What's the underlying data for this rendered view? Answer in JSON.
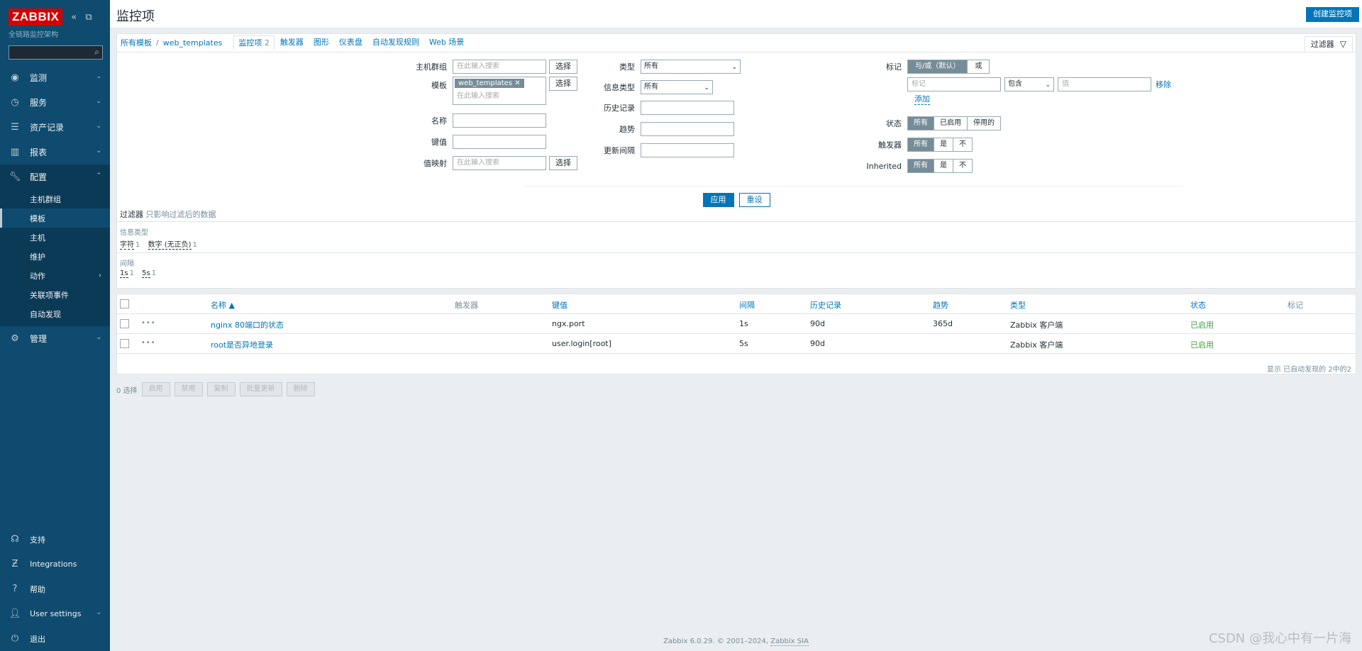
{
  "sidebar": {
    "logo": "ZABBIX",
    "collapse_icons": "«  ⧉",
    "subtitle": "全链路监控架构",
    "search_placeholder": "",
    "menu": [
      {
        "label": "监测",
        "icon": "eye-icon"
      },
      {
        "label": "服务",
        "icon": "clock-icon"
      },
      {
        "label": "资产记录",
        "icon": "list-icon"
      },
      {
        "label": "报表",
        "icon": "chart-icon"
      },
      {
        "label": "配置",
        "icon": "wrench-icon"
      },
      {
        "label": "管理",
        "icon": "gear-icon"
      }
    ],
    "submenu": [
      "主机群组",
      "模板",
      "主机",
      "维护",
      "动作",
      "关联项事件",
      "自动发现"
    ],
    "bottom": [
      {
        "label": "支持",
        "icon": "headset-icon"
      },
      {
        "label": "Integrations",
        "icon": "integrations-icon"
      },
      {
        "label": "帮助",
        "icon": "help-icon"
      },
      {
        "label": "User settings",
        "icon": "user-icon"
      },
      {
        "label": "退出",
        "icon": "power-icon"
      }
    ]
  },
  "header": {
    "title": "监控项",
    "create_button": "创建监控项"
  },
  "breadcrumbs": {
    "all_templates": "所有模板",
    "separator": "/",
    "template": "web_templates",
    "tabs": [
      {
        "label": "监控项",
        "count": "2"
      },
      {
        "label": "触发器",
        "count": ""
      },
      {
        "label": "图形",
        "count": ""
      },
      {
        "label": "仪表盘",
        "count": ""
      },
      {
        "label": "自动发现规则",
        "count": ""
      },
      {
        "label": "Web 场景",
        "count": ""
      }
    ],
    "filter_tab": "过滤器"
  },
  "filter": {
    "host_groups_label": "主机群组",
    "host_groups_placeholder": "在此输入搜索",
    "select_button": "选择",
    "templates_label": "模板",
    "templates_chip": "web_templates",
    "templates_placeholder": "在此输入搜索",
    "name_label": "名称",
    "key_label": "键值",
    "value_map_label": "值映射",
    "value_map_placeholder": "在此输入搜索",
    "type_label": "类型",
    "type_value": "所有",
    "info_type_label": "信息类型",
    "info_type_value": "所有",
    "history_label": "历史记录",
    "trends_label": "趋势",
    "update_interval_label": "更新间隔",
    "tags_label": "标记",
    "tags_and_or": "与/或（默认）",
    "tags_or": "或",
    "tag_placeholder": "标记",
    "tag_op": "包含",
    "value_placeholder": "值",
    "remove": "移除",
    "add": "添加",
    "state_label": "状态",
    "state_options": [
      "所有",
      "已启用",
      "停用的"
    ],
    "triggers_label": "触发器",
    "triggers_options": [
      "所有",
      "是",
      "不"
    ],
    "inherited_label": "Inherited",
    "inherited_options": [
      "所有",
      "是",
      "不"
    ],
    "apply": "应用",
    "reset": "重设"
  },
  "subfilter": {
    "title": "过滤器",
    "hint": "只影响过滤后的数据",
    "info_type_label": "信息类型",
    "info_type_values": [
      {
        "v": "字符",
        "c": "1"
      },
      {
        "v": "数字 (无正负)",
        "c": "1"
      }
    ],
    "interval_label": "间隔",
    "interval_values": [
      {
        "v": "1s",
        "c": "1"
      },
      {
        "v": "5s",
        "c": "1"
      }
    ]
  },
  "table": {
    "columns": [
      "名称 ▲",
      "触发器",
      "键值",
      "间隔",
      "历史记录",
      "趋势",
      "类型",
      "状态",
      "标记"
    ],
    "rows": [
      {
        "name": "nginx 80端口的状态",
        "trigger": "",
        "key": "ngx.port",
        "interval": "1s",
        "history": "90d",
        "trends": "365d",
        "type": "Zabbix 客户端",
        "status": "已启用",
        "tags": ""
      },
      {
        "name": "root是否异地登录",
        "trigger": "",
        "key": "user.login[root]",
        "interval": "5s",
        "history": "90d",
        "trends": "",
        "type": "Zabbix 客户端",
        "status": "已启用",
        "tags": ""
      }
    ],
    "footer": "显示 已自动发现的 2中的2"
  },
  "mass": {
    "selected": "0 选择",
    "buttons": [
      "启用",
      "禁用",
      "复制",
      "批量更新",
      "删除"
    ]
  },
  "footer": {
    "text": "Zabbix 6.0.29. © 2001–2024,",
    "link": "Zabbix SIA"
  },
  "watermark": "CSDN @我心中有一片海",
  "colors": {
    "sidebar": "#0e4b6f",
    "accent": "#0275b8",
    "enabled": "#429e47",
    "logo": "#d40000"
  }
}
